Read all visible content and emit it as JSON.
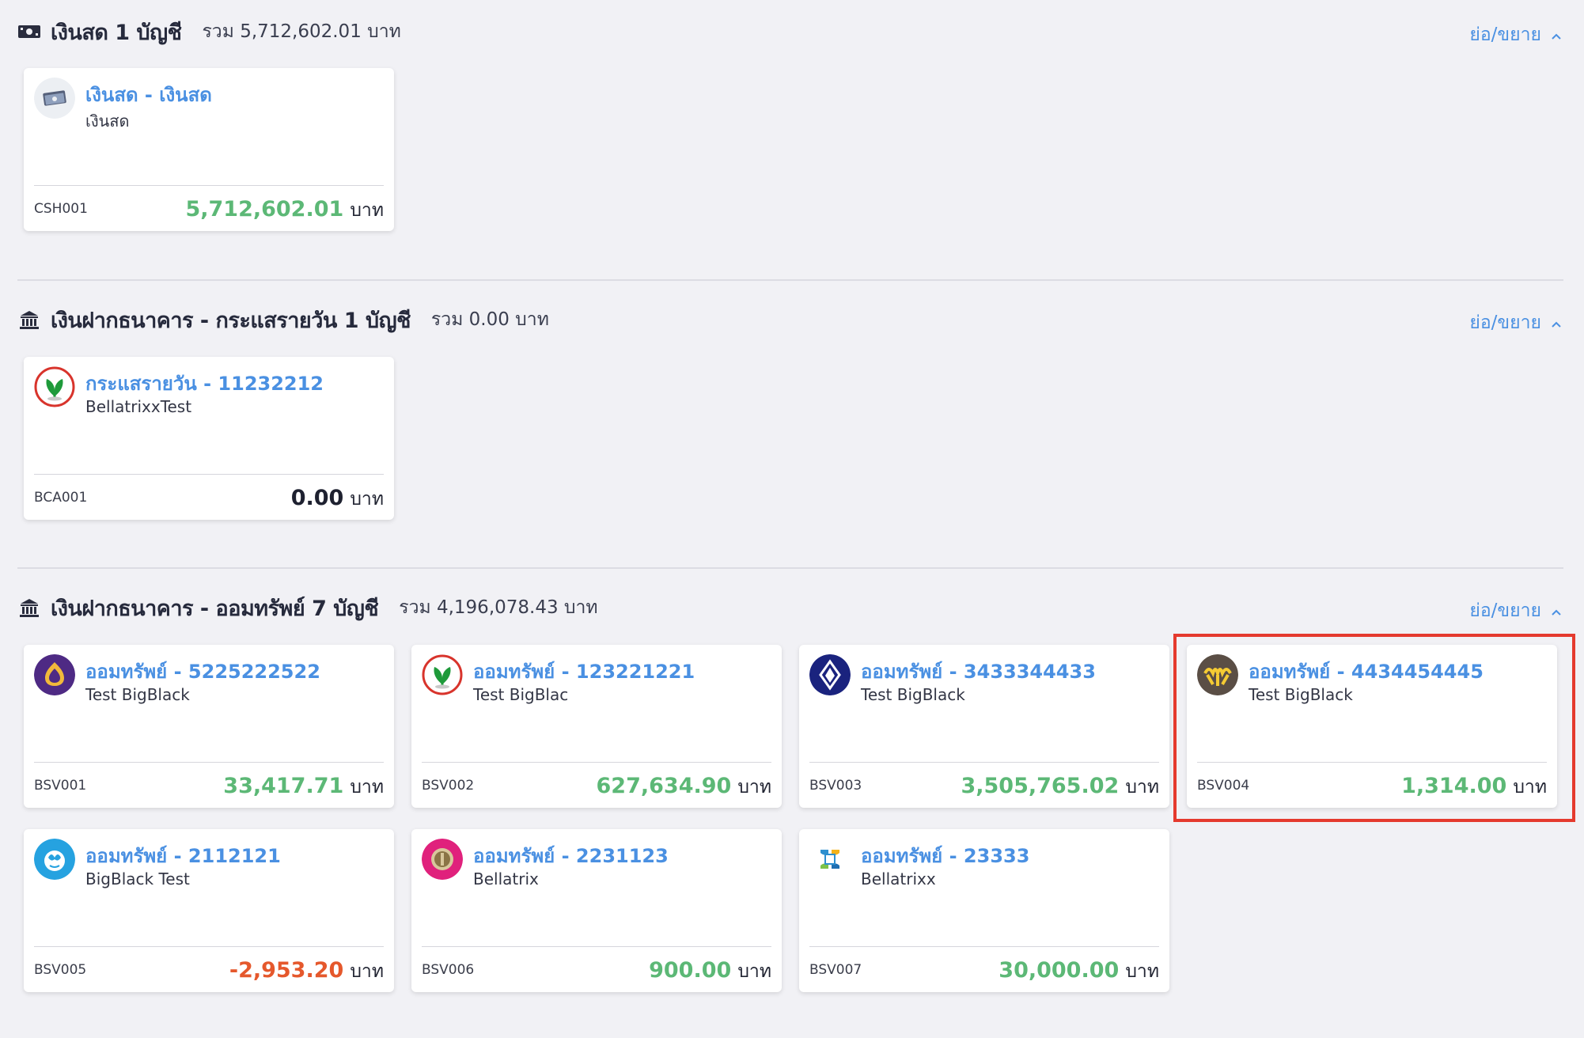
{
  "sections": [
    {
      "title": "เงินสด 1 บัญชี",
      "total": "รวม 5,712,602.01 บาท",
      "toggle": "ย่อ/ขยาย",
      "icon": "cash-icon",
      "accounts": [
        {
          "name": "เงินสด - เงินสด",
          "sub": "เงินสด",
          "code": "CSH001",
          "amount": "5,712,602.01",
          "unit": "บาท",
          "status": "positive",
          "logo": "cash-logo-icon"
        }
      ]
    },
    {
      "title": "เงินฝากธนาคาร - กระแสรายวัน 1 บัญชี",
      "total": "รวม 0.00 บาท",
      "toggle": "ย่อ/ขยาย",
      "icon": "bank-icon",
      "accounts": [
        {
          "name": "กระแสรายวัน - 11232212",
          "sub": "BellatrixxTest",
          "code": "BCA001",
          "amount": "0.00",
          "unit": "บาท",
          "status": "zero",
          "logo": "kbank-logo-icon"
        }
      ]
    },
    {
      "title": "เงินฝากธนาคาร - ออมทรัพย์ 7 บัญชี",
      "total": "รวม 4,196,078.43 บาท",
      "toggle": "ย่อ/ขยาย",
      "icon": "bank-icon",
      "accounts": [
        {
          "name": "ออมทรัพย์ - 5225222522",
          "sub": "Test BigBlack",
          "code": "BSV001",
          "amount": "33,417.71",
          "unit": "บาท",
          "status": "positive",
          "logo": "scb-logo-icon"
        },
        {
          "name": "ออมทรัพย์ - 123221221",
          "sub": "Test BigBlac",
          "code": "BSV002",
          "amount": "627,634.90",
          "unit": "บาท",
          "status": "positive",
          "logo": "kbank-logo-icon"
        },
        {
          "name": "ออมทรัพย์ - 3433344433",
          "sub": "Test BigBlack",
          "code": "BSV003",
          "amount": "3,505,765.02",
          "unit": "บาท",
          "status": "positive",
          "logo": "bbl-logo-icon"
        },
        {
          "name": "ออมทรัพย์ - 4434454445",
          "sub": "Test BigBlack",
          "code": "BSV004",
          "amount": "1,314.00",
          "unit": "บาท",
          "status": "positive",
          "logo": "krungsri-logo-icon"
        },
        {
          "name": "ออมทรัพย์ - 2112121",
          "sub": "BigBlack Test",
          "code": "BSV005",
          "amount": "-2,953.20",
          "unit": "บาท",
          "status": "negative",
          "logo": "ktb-logo-icon"
        },
        {
          "name": "ออมทรัพย์ - 2231123",
          "sub": "Bellatrix",
          "code": "BSV006",
          "amount": "900.00",
          "unit": "บาท",
          "status": "positive",
          "logo": "gsb-logo-icon"
        },
        {
          "name": "ออมทรัพย์ - 23333",
          "sub": "Bellatrixx",
          "code": "BSV007",
          "amount": "30,000.00",
          "unit": "บาท",
          "status": "positive",
          "logo": "tmb-logo-icon"
        }
      ]
    }
  ],
  "colors": {
    "link": "#4a90e2",
    "positive": "#5cb876",
    "negative": "#e5582c",
    "highlight": "#e53a2e"
  }
}
